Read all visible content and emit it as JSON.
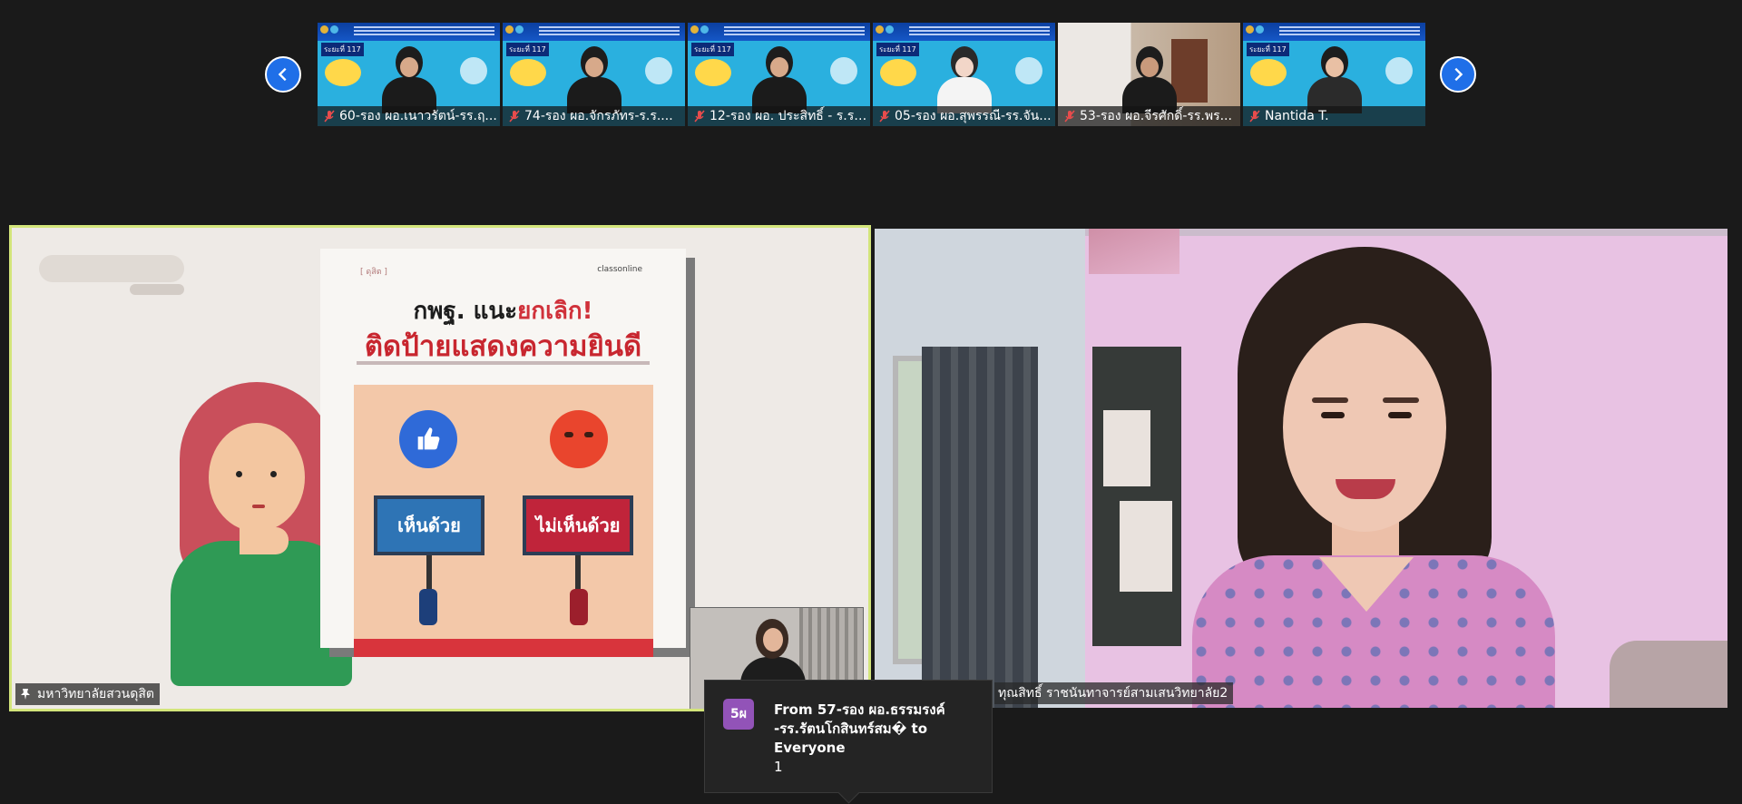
{
  "strip": {
    "prev_icon": "chevron-left-icon",
    "next_icon": "chevron-right-icon",
    "thumbnails": [
      {
        "name": "60-รอง ผอ.เนาวรัตน์-รร.ฤ...",
        "tag": "ระยะที่ 117",
        "muted": true
      },
      {
        "name": "74-รอง ผอ.จักรภัทร-ร.ร....",
        "tag": "ระยะที่ 117",
        "muted": true
      },
      {
        "name": "12-รอง ผอ. ประสิทธิ์ - ร.ร. ...",
        "tag": "ระยะที่ 117",
        "muted": true
      },
      {
        "name": "05-รอง ผอ.สุพรรณี-รร.จัน...",
        "tag": "ระยะที่ 117",
        "muted": true
      },
      {
        "name": "53-รอง ผอ.จีรศักดิ์-รร.พร...",
        "tag": "",
        "muted": true
      },
      {
        "name": "Nantida T.",
        "tag": "ระยะที่ 117",
        "muted": true
      }
    ]
  },
  "share_tile": {
    "label": "มหาวิทยาลัยสวนดุสิต",
    "label_icon": "pin-icon",
    "poster": {
      "brand": "[ ดุสิต ]",
      "logo": "classonline",
      "headline_prefix": "กพฐ. แนะ",
      "headline_highlight": "ยกเลิก!",
      "title": "ติดป้ายแสดงความยินดี",
      "agree": "เห็นด้วย",
      "disagree": "ไม่เห็นด้วย"
    }
  },
  "speaker_tile": {
    "label": "ทุณสิทธิ์ ราชนันทาจารย์สามเสนวิทยาลัย2"
  },
  "chat_toast": {
    "avatar_initials": "5ผ",
    "header": "From 57-รอง ผอ.ธรรมรงค์ -รร.รัตนโกสินทร์สม� to Everyone",
    "message": "1"
  },
  "colors": {
    "active_speaker_border": "#d3e57a",
    "nav_button": "#1f6fe8",
    "avatar": "#9253b8"
  }
}
